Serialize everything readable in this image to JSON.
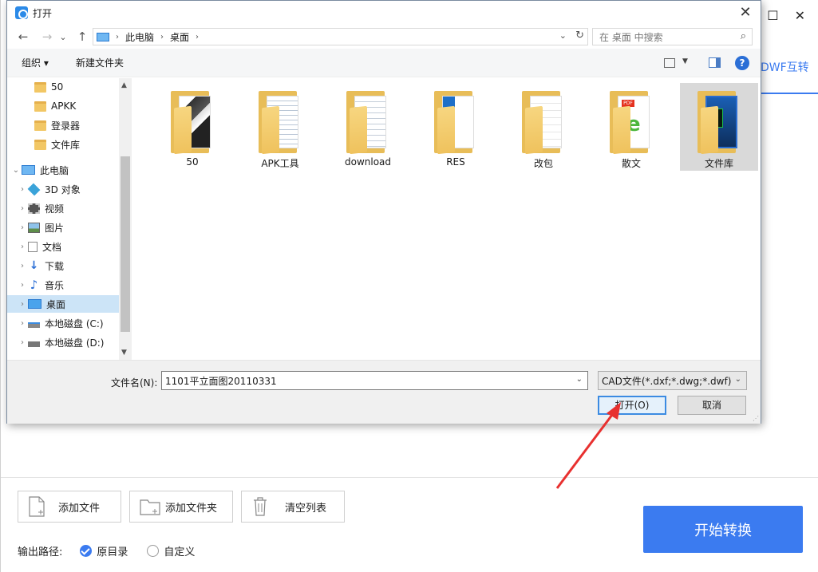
{
  "background_app": {
    "tab_label": "DWF互转",
    "win_buttons": [
      "☐",
      "✕"
    ],
    "buttons": {
      "add_file": "添加文件",
      "add_folder": "添加文件夹",
      "clear_list": "清空列表",
      "start": "开始转换"
    },
    "output": {
      "label": "输出路径:",
      "option_original": "原目录",
      "option_custom": "自定义",
      "selected": "原目录"
    },
    "accent_color": "#3b7bf0"
  },
  "dialog": {
    "title": "打开",
    "close_glyph": "✕",
    "nav": {
      "back": "←",
      "forward": "→",
      "recent": "⌄",
      "up": "↑",
      "breadcrumb": [
        "此电脑",
        "桌面"
      ],
      "search_placeholder": "在 桌面 中搜索"
    },
    "toolbar": {
      "organize": "组织 ▾",
      "new_folder": "新建文件夹",
      "help": "?"
    },
    "sidebar": {
      "items": [
        {
          "label": "50",
          "icon": "folder-icon",
          "indent": 2
        },
        {
          "label": "APKK",
          "icon": "folder-icon",
          "indent": 2
        },
        {
          "label": "登录器",
          "icon": "folder-icon",
          "indent": 2
        },
        {
          "label": "文件库",
          "icon": "folder-icon",
          "indent": 2
        },
        {
          "label": "此电脑",
          "icon": "computer-icon",
          "indent": 1,
          "expanded": true
        },
        {
          "label": "3D 对象",
          "icon": "3d-objects-icon",
          "indent": 2
        },
        {
          "label": "视频",
          "icon": "video-icon",
          "indent": 2
        },
        {
          "label": "图片",
          "icon": "pictures-icon",
          "indent": 2
        },
        {
          "label": "文档",
          "icon": "documents-icon",
          "indent": 2
        },
        {
          "label": "下载",
          "icon": "download-icon",
          "indent": 2
        },
        {
          "label": "音乐",
          "icon": "music-icon",
          "indent": 2
        },
        {
          "label": "桌面",
          "icon": "desktop-icon",
          "indent": 2,
          "selected": true
        },
        {
          "label": "本地磁盘 (C:)",
          "icon": "drive-c-icon",
          "indent": 2
        },
        {
          "label": "本地磁盘 (D:)",
          "icon": "drive-d-icon",
          "indent": 2
        }
      ]
    },
    "files": [
      {
        "label": "50",
        "content": "image"
      },
      {
        "label": "APK工具",
        "content": "document"
      },
      {
        "label": "download",
        "content": "document"
      },
      {
        "label": "RES",
        "content": "blue-document"
      },
      {
        "label": "改包",
        "content": "blank-document"
      },
      {
        "label": "散文",
        "content": "pdf-ie"
      },
      {
        "label": "文件库",
        "content": "cad",
        "selected": true
      }
    ],
    "filename": {
      "label": "文件名(N):",
      "value": "1101平立面图20110331"
    },
    "filetype": {
      "value": "CAD文件(*.dxf;*.dwg;*.dwf)"
    },
    "buttons": {
      "open": "打开(O)",
      "cancel": "取消"
    }
  }
}
